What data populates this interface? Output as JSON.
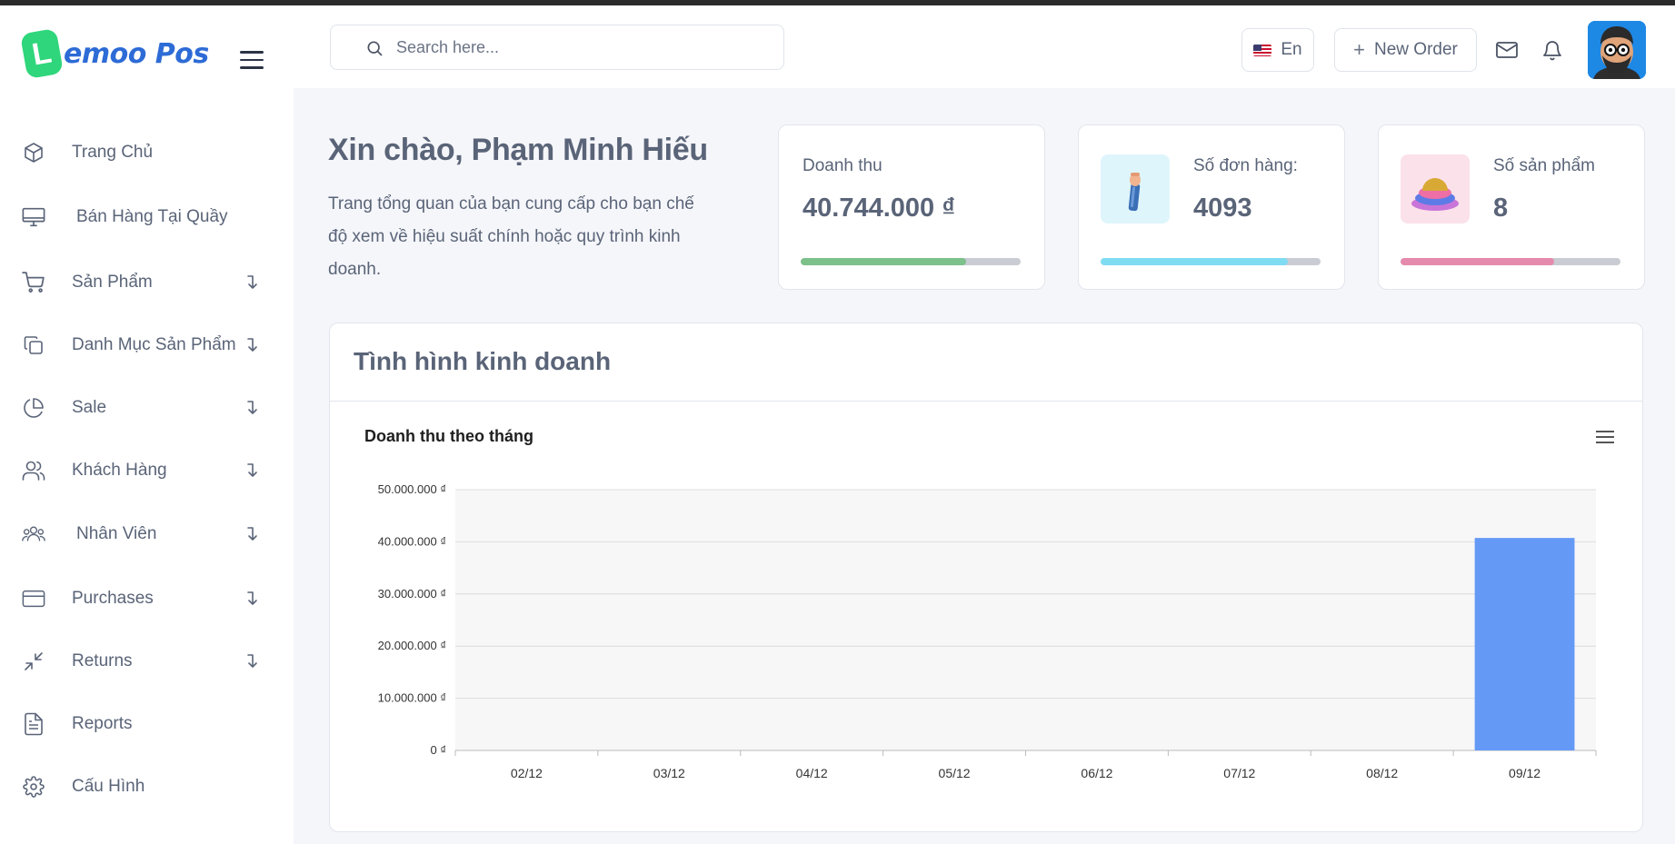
{
  "brand": {
    "logo_letter": "L",
    "name": "emoo Pos"
  },
  "sidebar": {
    "items": [
      {
        "label": "Trang Chủ",
        "icon": "cube-icon",
        "has_arrow": false
      },
      {
        "label": "Bán Hàng Tại Quầy",
        "icon": "monitor-icon",
        "has_arrow": false
      },
      {
        "label": "Sản Phẩm",
        "icon": "cart-icon",
        "has_arrow": true
      },
      {
        "label": "Danh Mục Sản Phẩm",
        "icon": "copy-icon",
        "has_arrow": true
      },
      {
        "label": "Sale",
        "icon": "pie-chart-icon",
        "has_arrow": true
      },
      {
        "label": "Khách Hàng",
        "icon": "users-icon",
        "has_arrow": true
      },
      {
        "label": "Nhân Viên",
        "icon": "team-icon",
        "has_arrow": true
      },
      {
        "label": "Purchases",
        "icon": "credit-card-icon",
        "has_arrow": true
      },
      {
        "label": "Returns",
        "icon": "minimize-icon",
        "has_arrow": true
      },
      {
        "label": "Reports",
        "icon": "file-text-icon",
        "has_arrow": false
      },
      {
        "label": "Cấu Hình",
        "icon": "gear-icon",
        "has_arrow": false
      }
    ]
  },
  "topbar": {
    "search_placeholder": "Search here...",
    "language": "En",
    "new_order_label": "New Order"
  },
  "greeting": {
    "title": "Xin chào, Phạm Minh Hiếu",
    "description": "Trang tổng quan của bạn cung cấp cho bạn chế độ xem về hiệu suất chính hoặc quy trình kinh doanh."
  },
  "stats": {
    "revenue": {
      "title": "Doanh thu",
      "value": "40.744.000 ₫",
      "progress": 0.75,
      "color": "#7cc08a"
    },
    "orders": {
      "title": "Số đơn hàng:",
      "value": "4093",
      "progress": 0.85,
      "color": "#7fdcf3"
    },
    "products": {
      "title": "Số sản phẩm",
      "value": "8",
      "progress": 0.7,
      "color": "#e58aad"
    }
  },
  "panel": {
    "title": "Tình hình kinh doanh"
  },
  "chart_data": {
    "type": "bar",
    "title": "Doanh thu theo tháng",
    "categories": [
      "02/12",
      "03/12",
      "04/12",
      "05/12",
      "06/12",
      "07/12",
      "08/12",
      "09/12"
    ],
    "values": [
      0,
      0,
      0,
      0,
      0,
      0,
      0,
      40744000
    ],
    "ylim": [
      0,
      50000000
    ],
    "yticks": [
      "0 ₫",
      "10.000.000 ₫",
      "20.000.000 ₫",
      "30.000.000 ₫",
      "40.000.000 ₫",
      "50.000.000 ₫"
    ],
    "ytick_values": [
      0,
      10000000,
      20000000,
      30000000,
      40000000,
      50000000
    ],
    "grid": true,
    "bar_color": "#6499f5"
  }
}
